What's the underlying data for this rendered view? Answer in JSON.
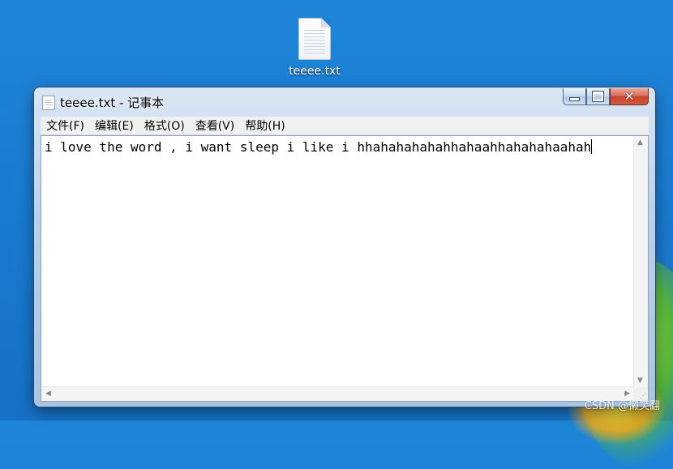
{
  "desktop": {
    "icon_label": "teeee.txt",
    "watermark": "CSDN @懒笑翻"
  },
  "window": {
    "title": "teeee.txt - 记事本",
    "icon": "notepad-icon",
    "caption_buttons": [
      "minimize-icon",
      "maximize-icon",
      "close-icon"
    ]
  },
  "menu": {
    "items": [
      "文件(F)",
      "编辑(E)",
      "格式(O)",
      "查看(V)",
      "帮助(H)"
    ]
  },
  "editor": {
    "content": "i love the word , i want sleep i like i hhahahahahahhahaahhahahahaahah"
  },
  "colors": {
    "desktop_blue": "#1a7bd0",
    "window_frame": "#b9d1ea",
    "close_red": "#c6452f"
  }
}
